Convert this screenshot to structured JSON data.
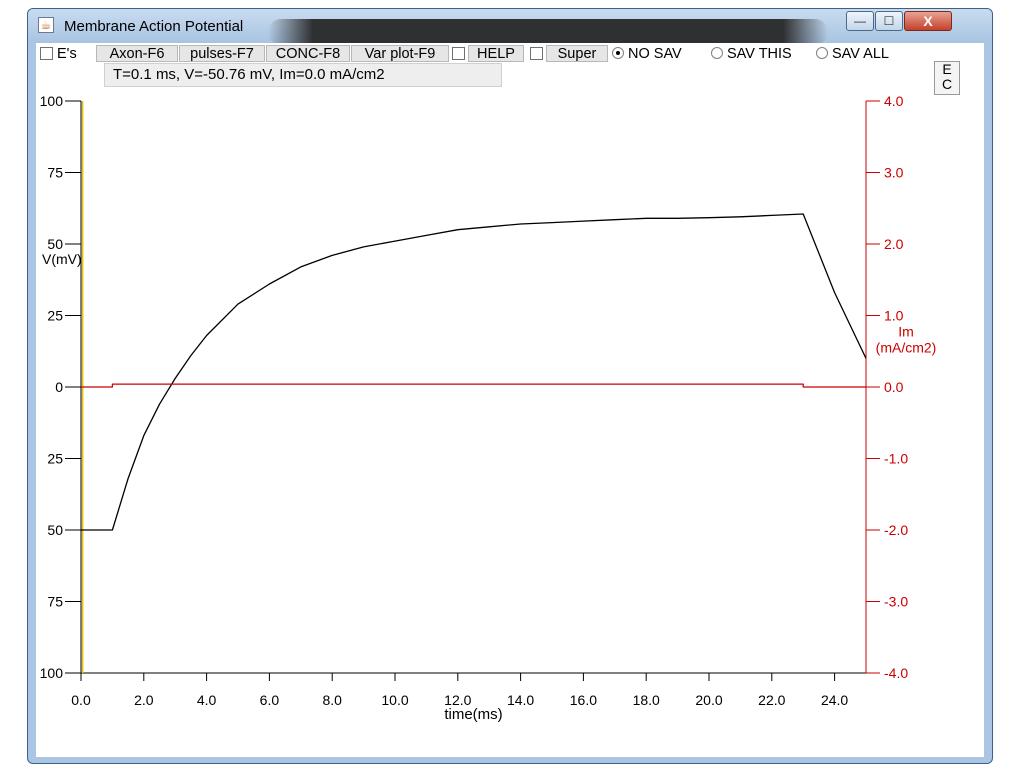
{
  "window": {
    "title": "Membrane Action Potential"
  },
  "window_buttons": {
    "minimize": "—",
    "maximize": "☐",
    "close": "X"
  },
  "toolbar": {
    "es_label": "E's",
    "axon_button": "Axon-F6",
    "pulses_button": "pulses-F7",
    "conc_button": "CONC-F8",
    "varplot_button": "Var plot-F9",
    "help_label": "HELP",
    "super_label": "Super",
    "radio_nosav": "NO SAV",
    "radio_savthis": "SAV THIS",
    "radio_savall": "SAV ALL",
    "selected_radio": "NO SAV",
    "corner_e": "E",
    "corner_c": "C"
  },
  "status": {
    "readout": "T=0.1 ms, V=-50.76 mV, Im=0.0 mA/cm2"
  },
  "colors": {
    "voltage_trace": "#000000",
    "current_trace": "#cc0000",
    "right_axis": "#cc0000",
    "time_cursor": "#e8c200"
  },
  "chart_data": {
    "type": "line",
    "xlabel": "time(ms)",
    "ylabel_left": "V(mV)",
    "ylabel_right_line1": "Im",
    "ylabel_right_line2": "(mA/cm2)",
    "xlim": [
      0,
      25.0
    ],
    "ylim_left": [
      -100,
      100
    ],
    "ylim_right": [
      -4.0,
      4.0
    ],
    "x_ticks": [
      "0.0",
      "2.0",
      "4.0",
      "6.0",
      "8.0",
      "10.0",
      "12.0",
      "14.0",
      "16.0",
      "18.0",
      "20.0",
      "22.0",
      "24.0"
    ],
    "y_left_ticks_visible": [
      "100",
      "75",
      "50",
      "25",
      "0",
      "25",
      "50",
      "75",
      "100"
    ],
    "y_left_tick_values": [
      100,
      75,
      50,
      25,
      0,
      -25,
      -50,
      -75,
      -100
    ],
    "y_right_ticks": [
      "4.0",
      "3.0",
      "2.0",
      "1.0",
      "0.0",
      "-1.0",
      "-2.0",
      "-3.0",
      "-4.0"
    ],
    "series": [
      {
        "axis": "left",
        "x": [
          0.0,
          1.0,
          1.5,
          2.0,
          2.5,
          3.0,
          3.5,
          4.0,
          5.0,
          6.0,
          7.0,
          8.0,
          9.0,
          10.0,
          11.0,
          12.0,
          13.0,
          14.0,
          15.0,
          16.0,
          17.0,
          18.0,
          19.0,
          20.0,
          21.0,
          22.0,
          23.0,
          24.0,
          25.0
        ],
        "values": [
          -50,
          -50,
          -32,
          -17,
          -6,
          3,
          11,
          18,
          29,
          36,
          42,
          46,
          49,
          51,
          53,
          55,
          56,
          57,
          57.5,
          58,
          58.5,
          59,
          59,
          59.2,
          59.5,
          60,
          60.5,
          33,
          10
        ]
      },
      {
        "axis": "right",
        "x": [
          0.0,
          1.0,
          1.0,
          23.0,
          23.0,
          25.0
        ],
        "values": [
          0.0,
          0.0,
          0.04,
          0.04,
          0.0,
          0.0
        ]
      }
    ],
    "cursor_x": 0.1
  }
}
